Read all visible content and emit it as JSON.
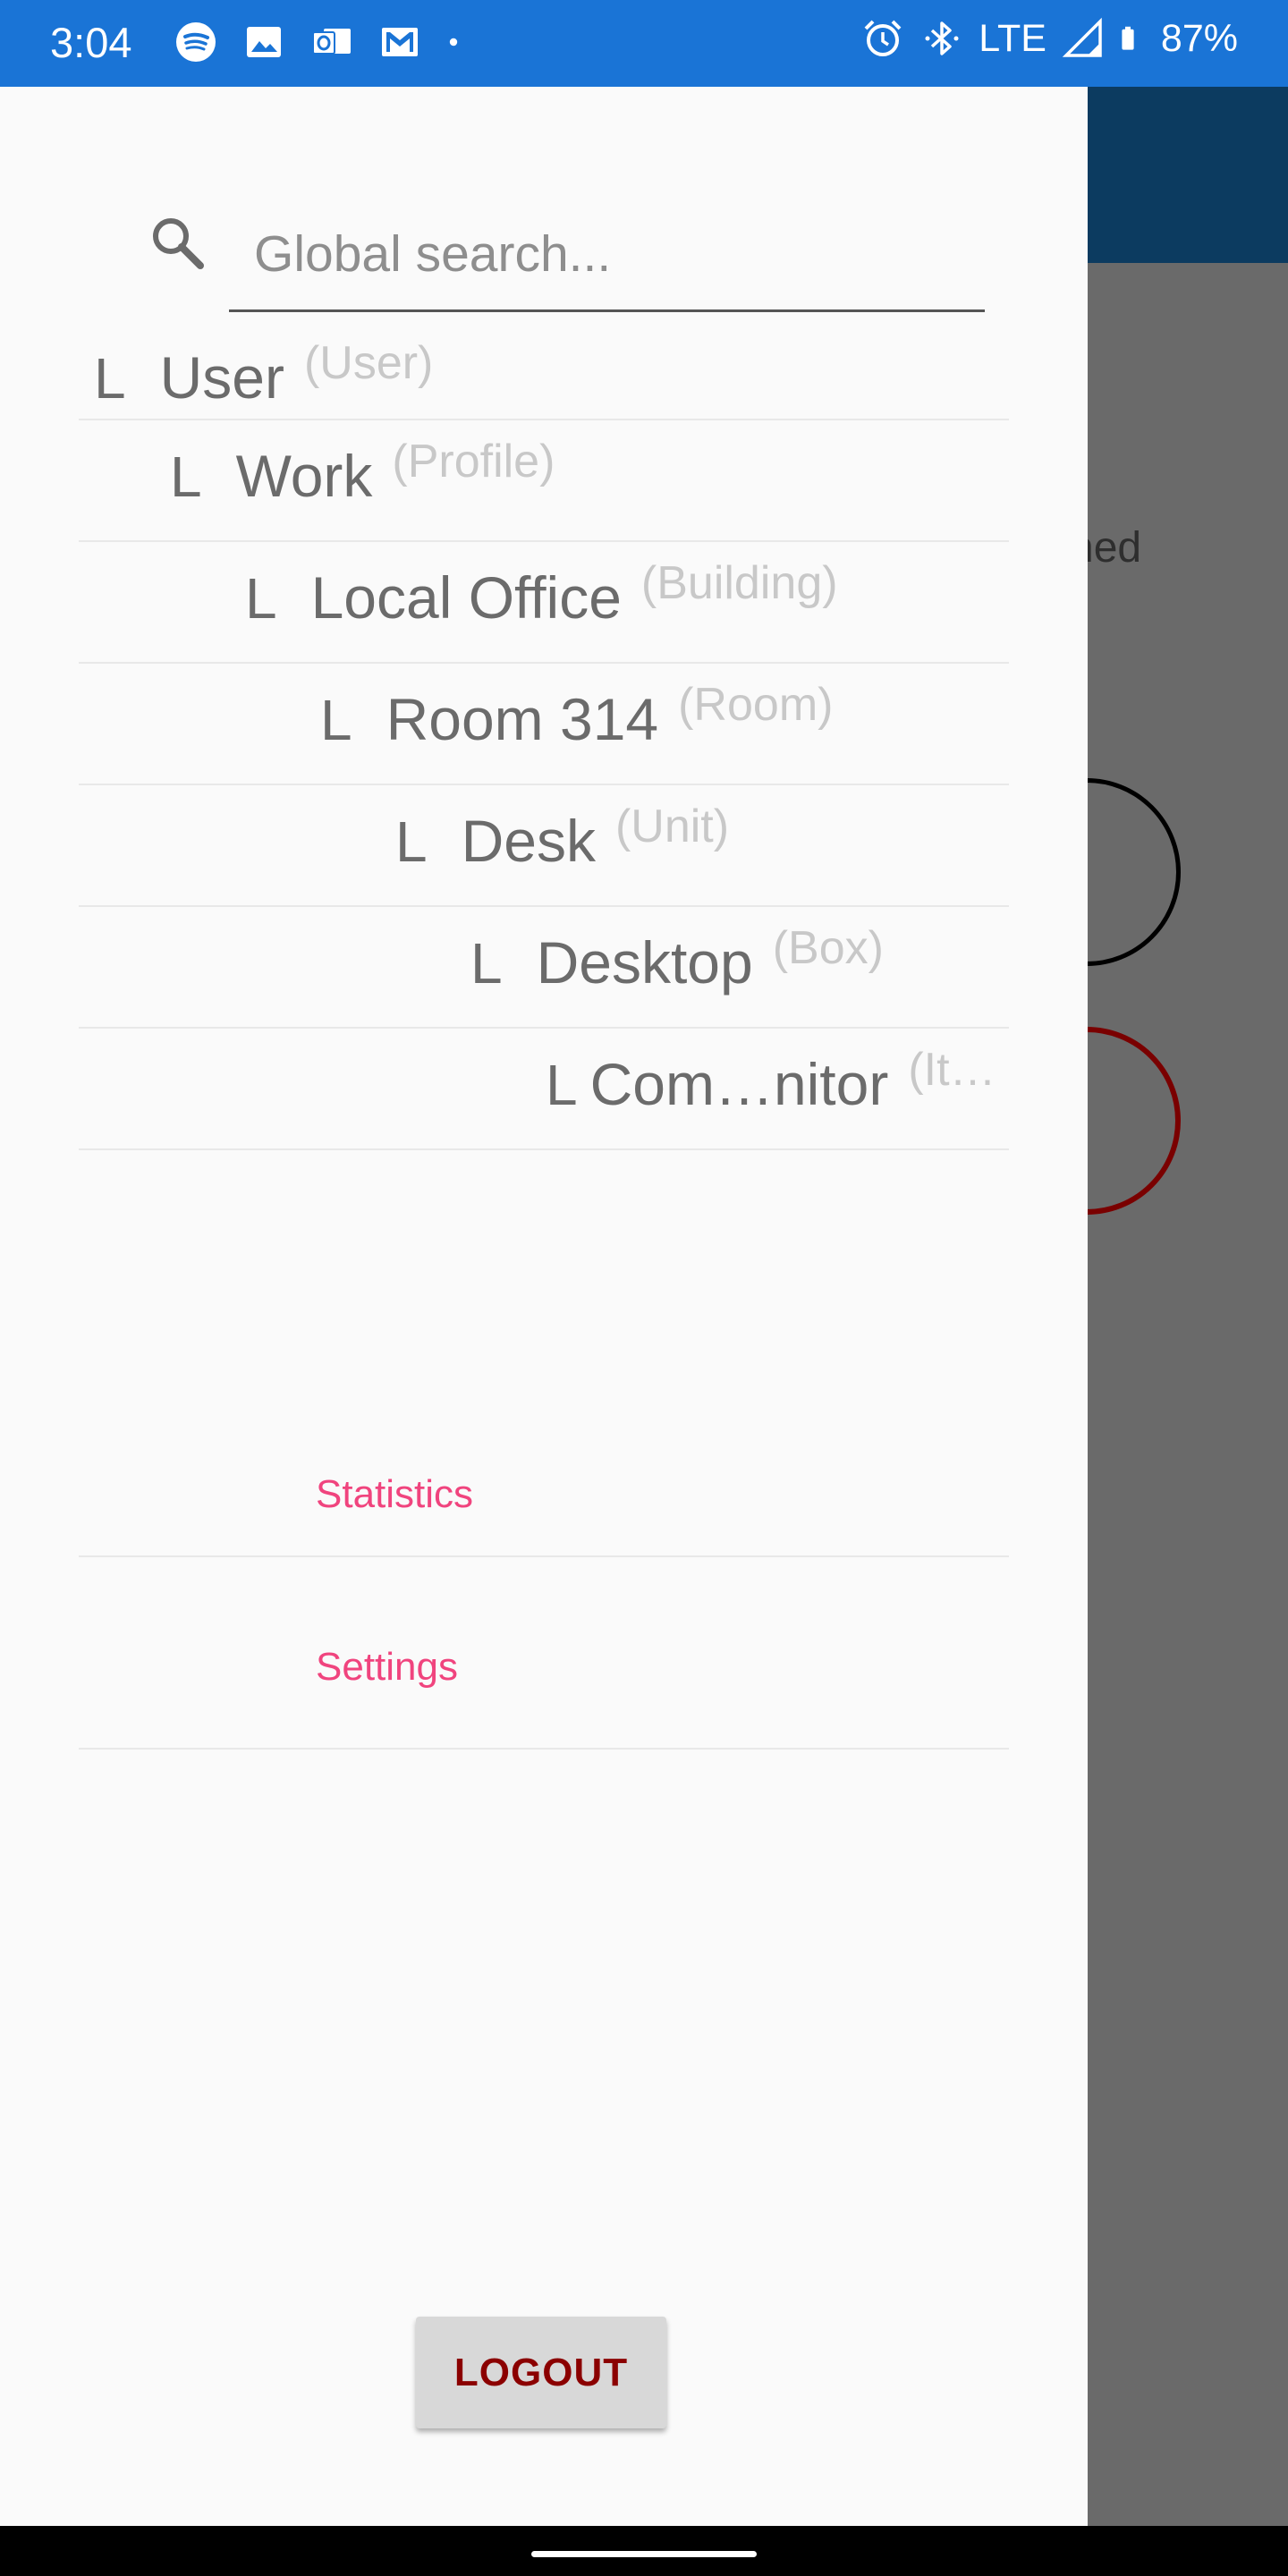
{
  "status_bar": {
    "time": "3:04",
    "left_icons": [
      "spotify-icon",
      "photos-icon",
      "outlook-icon",
      "gmail-icon",
      "dot-icon"
    ],
    "network": "LTE",
    "battery": "87%"
  },
  "background": {
    "partial_text": "ned"
  },
  "search": {
    "placeholder": "Global search..."
  },
  "tree": [
    {
      "marker": "L",
      "name": "User",
      "type": "(User)"
    },
    {
      "marker": "L",
      "name": "Work",
      "type": "(Profile)"
    },
    {
      "marker": "L",
      "name": "Local Office",
      "type": "(Building)"
    },
    {
      "marker": "L",
      "name": "Room 314",
      "type": "(Room)"
    },
    {
      "marker": "L",
      "name": "Desk",
      "type": "(Unit)"
    },
    {
      "marker": "L",
      "name": "Desktop",
      "type": "(Box)"
    },
    {
      "marker": "L",
      "name": "Com…nitor",
      "type": "(It…"
    }
  ],
  "menu": {
    "statistics": "Statistics",
    "settings": "Settings"
  },
  "logout_label": "LOGOUT"
}
